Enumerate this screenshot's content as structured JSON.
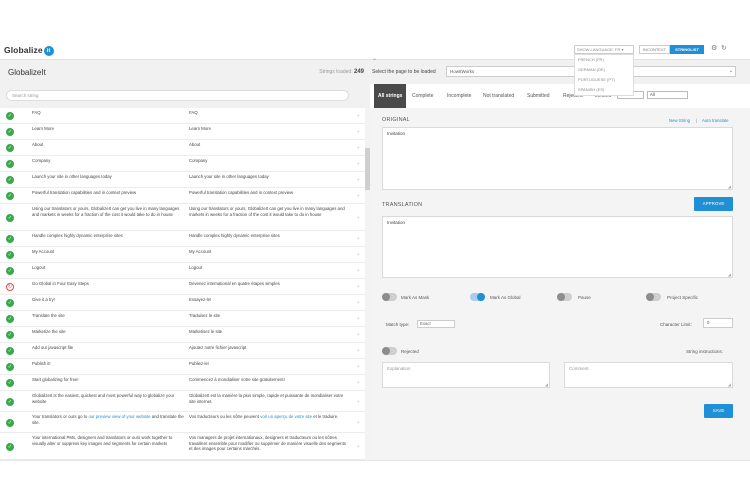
{
  "app": {
    "logo_text": "Globalize",
    "logo_badge": "it"
  },
  "topbar": {
    "language_select": "SHOW LANGUAGE: FR ▾",
    "language_options": [
      "FRENCH (FR)",
      "GERMAN (DE)",
      "PORTUGUESE (PT)",
      "SPANISH (ES)"
    ],
    "incontext_label": "INCONTEXT",
    "stringlist_label": "STRINGLIST",
    "accent": "#1f8fd6"
  },
  "left_panel": {
    "title": "GlobalizeIt",
    "strings_loaded_label": "Strings loaded:",
    "strings_loaded_count": "249",
    "search_placeholder": "Search string"
  },
  "right_panel": {
    "page_label": "Select the page to be loaded",
    "page_value": "HowItWorks"
  },
  "tabs": {
    "all": "All strings",
    "complete": "Complete",
    "incomplete": "Incomplete",
    "not_translated": "Not translated",
    "submitted": "Submitted",
    "rejected": "Rejected",
    "limited": "Limited",
    "filter1": "All",
    "filter2": "All"
  },
  "strings": [
    {
      "original": "FAQ",
      "translation": "FAQ",
      "status": "ok"
    },
    {
      "original": "Learn More",
      "translation": "Learn More",
      "status": "ok"
    },
    {
      "original": "About",
      "translation": "About",
      "status": "ok"
    },
    {
      "original": "Company",
      "translation": "Company",
      "status": "ok"
    },
    {
      "original": "Launch your site in other languages today",
      "translation": "Launch your site in other languages today",
      "status": "ok"
    },
    {
      "original": "Powerful translation capabilities and in context preview",
      "translation": "Powerful translation capabilities and in context preview",
      "status": "ok"
    },
    {
      "original": "Using our translators or yours, GlobalizeIt can get you live in many languages and markets in weeks for a fraction of the cost it would take to do in house",
      "translation": "Using our translators or yours, GlobalizeIt can get you live in many languages and markets in weeks for a fraction of the cost it would take to do in house",
      "status": "ok"
    },
    {
      "original": "Handle complex highly dynamic enterprise sites",
      "translation": "Handle complex highly dynamic enterprise sites",
      "status": "ok"
    },
    {
      "original": "My Account",
      "translation": "My Account",
      "status": "ok"
    },
    {
      "original": "Logout",
      "translation": "Logout",
      "status": "ok"
    },
    {
      "original": "Go Global in Four Easy Steps",
      "translation": "Devenez international en quatre étapes simples",
      "status": "pending"
    },
    {
      "original": "Give it a try!",
      "translation": "Essayez-le!",
      "status": "ok"
    },
    {
      "original": "Translate the site",
      "translation": "Traduisez le site",
      "status": "ok"
    },
    {
      "original": "Marketize the site",
      "translation": "Marketisez le site",
      "status": "ok"
    },
    {
      "original": "Add our javascript file",
      "translation": "Ajoutez notre fichier javascript",
      "status": "ok"
    },
    {
      "original": "Publish it!",
      "translation": "Publiez-le!",
      "status": "ok"
    },
    {
      "original": "Start globalizing for free!",
      "translation": "Commencez à mondialiser votre site gratuitement!",
      "status": "ok"
    },
    {
      "original": "GlobalizeIt is the easiest, quickest and most powerful way to globalize your website",
      "translation": "GlobalizeIt est la manière la plus simple, rapide et puissante de mondialiser votre site internet.",
      "status": "ok"
    },
    {
      "original_pre": "Your translators or ours go to ",
      "original_link": "our preview view of your website",
      "original_post": " and translate the site.",
      "translation_pre": "Vos traducteurs ou les nôtre peuvent ",
      "translation_link": "voir un aperçu de votre site",
      "translation_post": " et le traduire.",
      "status": "ok",
      "has_link": true
    },
    {
      "original": "Your international PMs, designers and translators or ours work together to visually alter or suppress key images and segments for certain markets",
      "translation": "Vos managers de projet internationaux, designers et traducteurs ou les nôtres travaillent ensemble pour modifier ou supprimer de manière visuelle des segments et des images pour certains marchés.",
      "status": "ok"
    }
  ],
  "editor": {
    "original_label": "ORIGINAL",
    "new_string": "New String",
    "separator": "|",
    "auto_translate": "Auto translate",
    "original_text": "Invitation",
    "translation_label": "TRANSLATION",
    "approve": "APPROVE",
    "translation_text": "Invitation",
    "mark_as_mask": "Mark As Mask",
    "mark_as_global": "Mark As Global",
    "pause": "Pause",
    "project_specific": "Project Specific",
    "match_type_label": "Match type:",
    "match_type_value": "Exact",
    "character_limit_label": "Character Limit:",
    "character_limit_value": "0",
    "rejected": "Rejected",
    "string_instructions": "String instructions:",
    "explanation_placeholder": "Explanation",
    "comment_placeholder": "Comment",
    "save": "SAVE"
  }
}
